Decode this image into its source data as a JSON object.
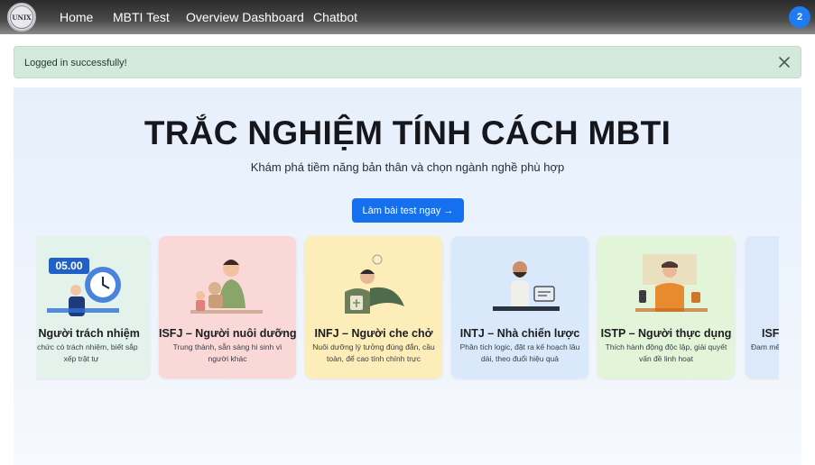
{
  "nav": {
    "logo_text": "UNIX",
    "links": [
      "Home",
      "MBTI Test",
      "Overview Dashboard",
      "Chatbot"
    ],
    "badge": "2"
  },
  "alert": {
    "message": "Logged in successfully!"
  },
  "hero": {
    "title": "TRẮC NGHIỆM TÍNH CÁCH MBTI",
    "subtitle": "Khám phá tiềm năng bản thân và chọn ngành nghề phù hợp",
    "cta": "Làm bài test ngay →"
  },
  "cards": [
    {
      "title": "I – Người trách nhiệm",
      "desc": "i tổ chức có trách nhiệm, biết sắp xếp trật tự",
      "clock": "05.00",
      "color": "#e3f3ec"
    },
    {
      "title": "ISFJ – Người nuôi dưỡng",
      "desc": "Trung thành, sẵn sàng hi sinh vì người khác",
      "color": "#fbd8d8"
    },
    {
      "title": "INFJ – Người che chở",
      "desc": "Nuôi dưỡng lý tưởng đúng đắn, cầu toàn, để cao tính chính trực",
      "color": "#fdeeb9"
    },
    {
      "title": "INTJ – Nhà chiến lược",
      "desc": "Phân tích logic, đặt ra kế hoạch lâu dài, theo đuổi hiệu quả",
      "color": "#d9e9fb"
    },
    {
      "title": "ISTP – Người thực dụng",
      "desc": "Thích hành động độc lập, giải quyết vấn đề linh hoạt",
      "color": "#e3f5d8"
    },
    {
      "title": "ISFI",
      "desc": "Đam mê lắ",
      "color": "#dbe9fb"
    }
  ]
}
